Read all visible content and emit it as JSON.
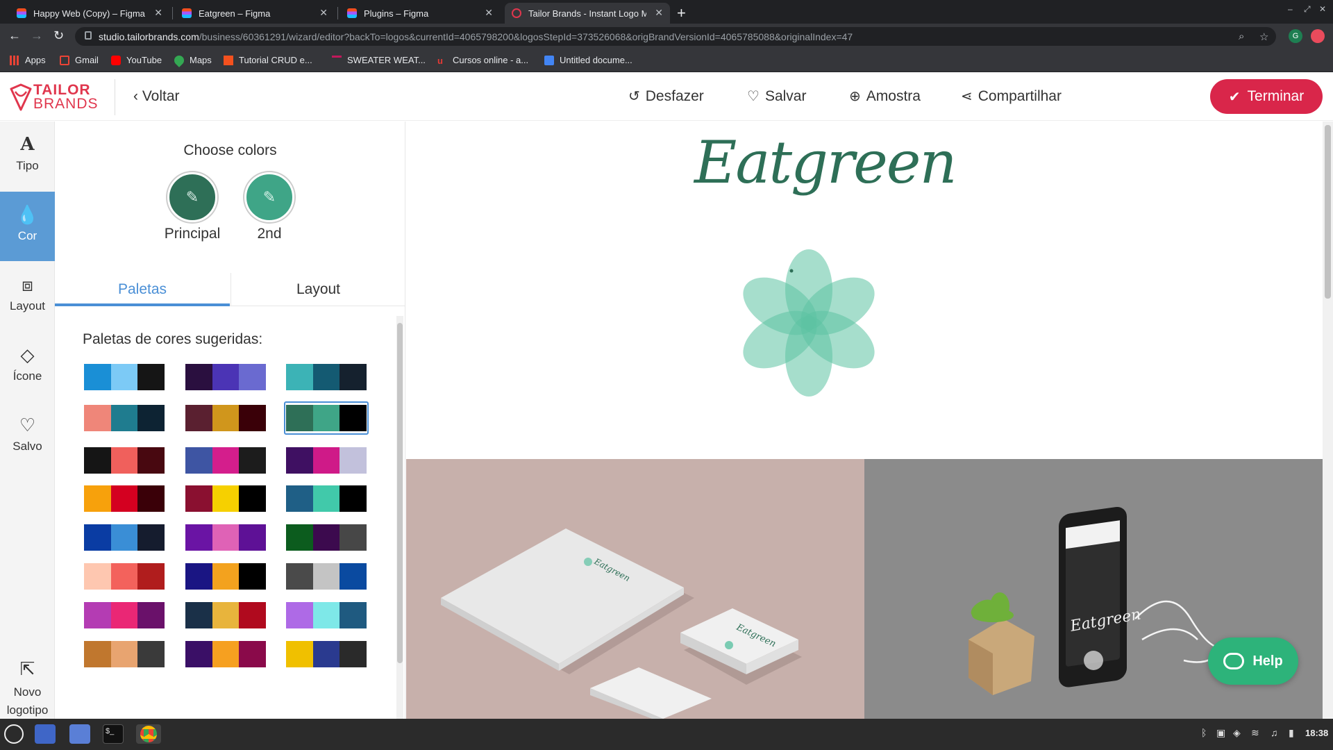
{
  "browser": {
    "tabs": [
      {
        "title": "Happy Web (Copy) – Figma",
        "active": false
      },
      {
        "title": "Eatgreen – Figma",
        "active": false
      },
      {
        "title": "Plugins – Figma",
        "active": false
      },
      {
        "title": "Tailor Brands - Instant Logo M",
        "active": true
      }
    ],
    "url_host": "studio.tailorbrands.com",
    "url_path": "/business/60361291/wizard/editor?backTo=logos&currentId=4065798200&logosStepId=373526068&origBrandVersionId=4065785088&originalIndex=47",
    "profile_initial": "G",
    "bookmarks": [
      {
        "label": "Apps",
        "icon": "apps-grid-icon",
        "color": "#ea4335"
      },
      {
        "label": "Gmail",
        "icon": "gmail-icon",
        "color": "#ea4335"
      },
      {
        "label": "YouTube",
        "icon": "youtube-icon",
        "color": "#ff0000"
      },
      {
        "label": "Maps",
        "icon": "maps-icon",
        "color": "#34a853"
      },
      {
        "label": "Tutorial CRUD e...",
        "icon": "laravel-icon",
        "color": "#f4511e"
      },
      {
        "label": "SWEATER WEAT...",
        "icon": "sweater-icon",
        "color": "#c2185b"
      },
      {
        "label": "Cursos online - a...",
        "icon": "udemy-icon",
        "color": "#e53935"
      },
      {
        "label": "Untitled docume...",
        "icon": "docs-icon",
        "color": "#4285f4"
      }
    ]
  },
  "header": {
    "brand_line1": "TAILOR",
    "brand_line2": "BRANDS",
    "back_label": "Voltar",
    "undo_label": "Desfazer",
    "save_label": "Salvar",
    "sample_label": "Amostra",
    "share_label": "Compartilhar",
    "finish_label": "Terminar"
  },
  "rail": [
    {
      "label": "Tipo",
      "icon": "type-icon",
      "active": false
    },
    {
      "label": "Cor",
      "icon": "color-drop-icon",
      "active": true
    },
    {
      "label": "Layout",
      "icon": "layout-icon",
      "active": false
    },
    {
      "label": "Ícone",
      "icon": "diamond-icon",
      "active": false
    },
    {
      "label": "Salvo",
      "icon": "heart-icon",
      "active": false
    },
    {
      "label": "Novo logotipo",
      "icon": "new-logo-icon",
      "active": false
    }
  ],
  "panel": {
    "title": "Choose colors",
    "swatches": [
      {
        "label": "Principal",
        "color": "#2e6f57"
      },
      {
        "label": "2nd",
        "color": "#3fa587"
      }
    ],
    "tabs": [
      {
        "label": "Paletas",
        "active": true
      },
      {
        "label": "Layout",
        "active": false
      }
    ],
    "palettes_title": "Paletas de cores sugeridas:",
    "palettes": [
      [
        "#1a8fd6",
        "#7ccaf6",
        "#151515"
      ],
      [
        "#2a0f3f",
        "#4b34b5",
        "#6a6ad0"
      ],
      [
        "#3cb3b6",
        "#145a72",
        "#15212e"
      ],
      [
        "#ef8679",
        "#1f7c8f",
        "#0d2333"
      ],
      [
        "#5a2030",
        "#d0961c",
        "#3a0008"
      ],
      [
        "#2e6f57",
        "#3fa587",
        "#000000"
      ],
      [
        "#151515",
        "#f0605c",
        "#480810"
      ],
      [
        "#3e55a3",
        "#d41e8c",
        "#1c1c1c"
      ],
      [
        "#3f1062",
        "#cf1a88",
        "#c2c1dc"
      ],
      [
        "#f7a10c",
        "#d40020",
        "#3a0008"
      ],
      [
        "#8a1030",
        "#f6d000",
        "#000000"
      ],
      [
        "#1f5f86",
        "#41c9aa",
        "#000000"
      ],
      [
        "#0a3ca3",
        "#3a8ed6",
        "#151c2e"
      ],
      [
        "#6a14a4",
        "#df62b6",
        "#5e1196"
      ],
      [
        "#0c5c1e",
        "#3c0a4e",
        "#474747"
      ],
      [
        "#fec7b0",
        "#f3625c",
        "#b01d1d"
      ],
      [
        "#1a1583",
        "#f3a21e",
        "#000000"
      ],
      [
        "#4a4a4a",
        "#c4c4c4",
        "#0a4aa0"
      ],
      [
        "#b43cb3",
        "#ea2775",
        "#6a116a"
      ],
      [
        "#1a3048",
        "#e8b43c",
        "#b00a1e"
      ],
      [
        "#ae6ae6",
        "#7ee8e8",
        "#1f5a80"
      ],
      [
        "#c0772e",
        "#e8a470",
        "#3a3a3a"
      ],
      [
        "#3a0f66",
        "#f6a020",
        "#8a0a4a"
      ],
      [
        "#f0c000",
        "#2a3a8f",
        "#2a2a2a"
      ]
    ],
    "selected_palette_index": 5
  },
  "canvas": {
    "logo_name": "Eatgreen",
    "brand_color": "#2e6f57",
    "icon_color": "#5cc2a3",
    "mockup_card_name": "Eatgreen",
    "mockup_phone_name": "Eatgreen",
    "help_label": "Help"
  },
  "taskbar": {
    "time": "18:38"
  }
}
